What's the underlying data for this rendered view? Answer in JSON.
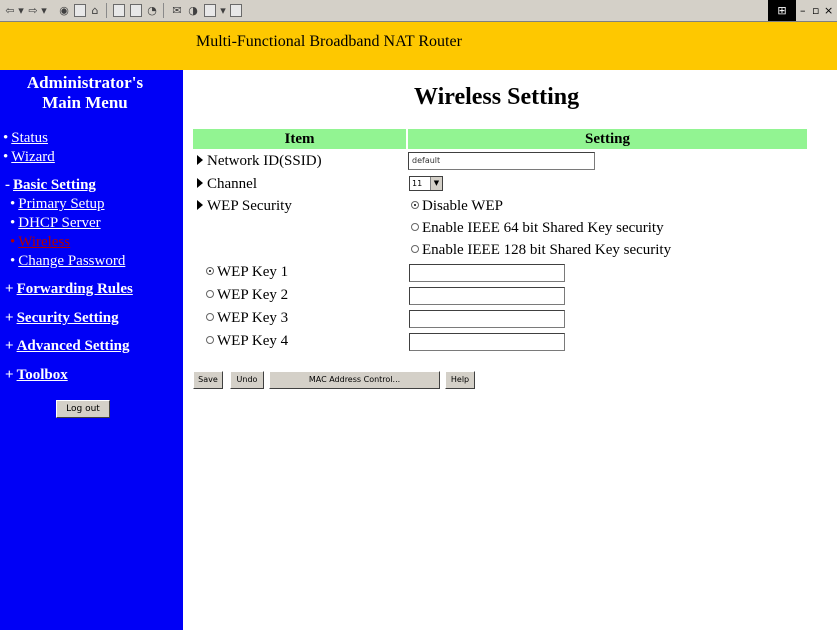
{
  "banner": {
    "title": "Multi-Functional Broadband NAT Router"
  },
  "sidebar": {
    "title_line1": "Administrator's",
    "title_line2": "Main Menu",
    "items": [
      {
        "label": "Status",
        "bullet": "•"
      },
      {
        "label": "Wizard",
        "bullet": "•"
      },
      {
        "label": "Basic Setting",
        "bullet": "-"
      },
      {
        "label": "Primary Setup",
        "bullet": "•"
      },
      {
        "label": "DHCP Server",
        "bullet": "•"
      },
      {
        "label": "Wireless",
        "bullet": "•"
      },
      {
        "label": "Change Password",
        "bullet": "•"
      },
      {
        "label": "Forwarding Rules",
        "bullet": "+"
      },
      {
        "label": "Security Setting",
        "bullet": "+"
      },
      {
        "label": "Advanced Setting",
        "bullet": "+"
      },
      {
        "label": "Toolbox",
        "bullet": "+"
      }
    ],
    "logout_label": "Log out"
  },
  "main": {
    "title": "Wireless Setting",
    "table_headers": {
      "item": "Item",
      "setting": "Setting"
    },
    "ssid": {
      "label": "Network ID(SSID)",
      "value": "default"
    },
    "channel": {
      "label": "Channel",
      "value": "11"
    },
    "wep": {
      "label": "WEP Security",
      "options": [
        "Disable WEP",
        "Enable IEEE 64 bit Shared Key security",
        "Enable IEEE 128 bit Shared Key security"
      ],
      "selected_index": 0
    },
    "wep_keys": [
      {
        "label": "WEP Key 1",
        "value": ""
      },
      {
        "label": "WEP Key 2",
        "value": ""
      },
      {
        "label": "WEP Key 3",
        "value": ""
      },
      {
        "label": "WEP Key 4",
        "value": ""
      }
    ],
    "buttons": {
      "save": "Save",
      "undo": "Undo",
      "mac": "MAC Address Control...",
      "help": "Help"
    }
  },
  "colors": {
    "banner": "#fec800",
    "sidebar": "#0000f6",
    "table_header": "#92f492",
    "active_nav": "#b00000"
  }
}
